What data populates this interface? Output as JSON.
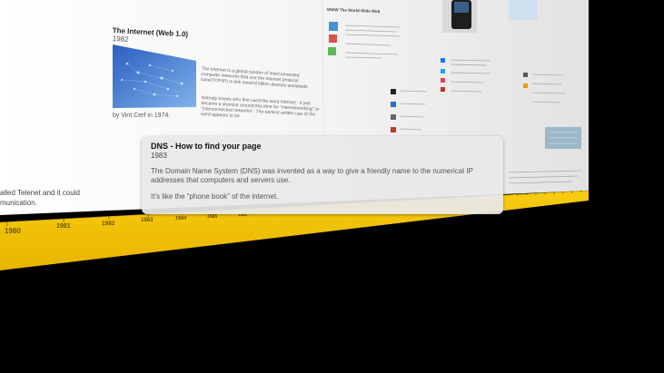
{
  "card_internet": {
    "title": "The Internet (Web 1.0)",
    "year": "1982",
    "text_1": "The Internet is a global system of interconnected computer networks that use the Internet protocol suite(TCP/IP) to link several billion devices worldwide.",
    "text_2": "Nobody knows who first used the word Internet - it just became a shortcut around this time for \"internetworking\" or \"interconnected networks\". The earliest written use of the word appears to be",
    "credit": "by Vint Cerf in 1974."
  },
  "card_www": {
    "title": "WWW The World Wide Web"
  },
  "left_fragment": {
    "line_1": "alled Telenet and it could",
    "line_2": "munication."
  },
  "tooltip": {
    "title": "DNS - How to find your page",
    "year": "1983",
    "body": "The Domain Name System (DNS) was invented as a way to give a friendly name to the numerical IP addresses that computers and servers use.",
    "body_2": "It's like the “phone book” of the internet."
  },
  "timeline": {
    "years": [
      "1980",
      "1981",
      "1982",
      "1983",
      "1984",
      "1985",
      "1986"
    ]
  },
  "colors": {
    "timeline_bar": "#f2c200",
    "background": "#000000",
    "wall": "#ffffff"
  }
}
